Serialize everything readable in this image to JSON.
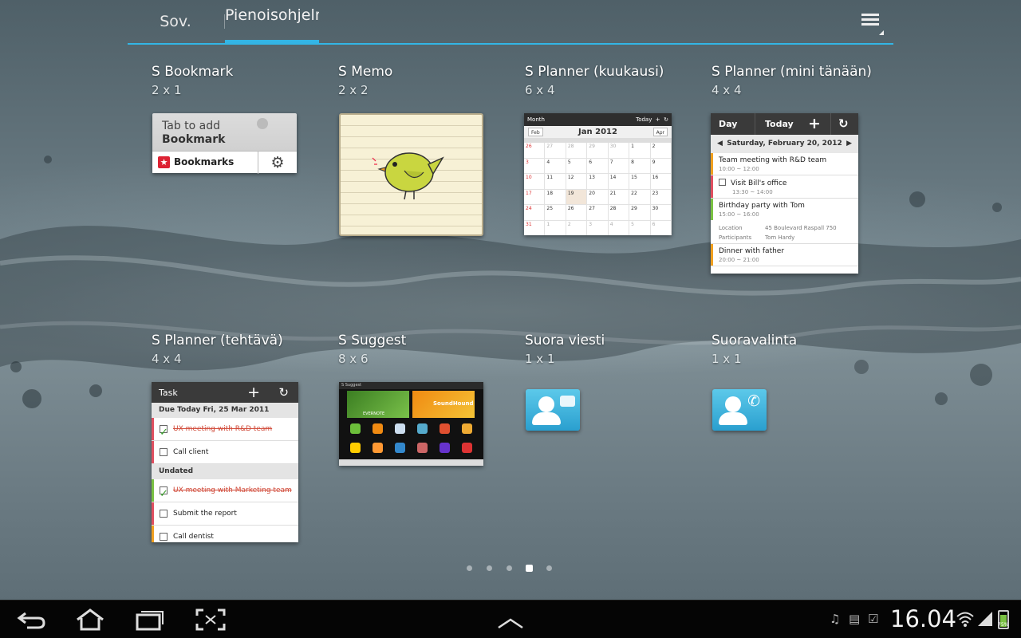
{
  "tabs": {
    "apps": "Sov.",
    "widgets": "Pienoisohjelmat"
  },
  "widgets": [
    {
      "title": "S Bookmark",
      "size": "2 x 1"
    },
    {
      "title": "S Memo",
      "size": "2 x 2"
    },
    {
      "title": "S Planner (kuukausi)",
      "size": "6 x 4"
    },
    {
      "title": "S Planner (mini tänään)",
      "size": "4 x 4"
    },
    {
      "title": "S Planner (tehtävä)",
      "size": "4 x 4"
    },
    {
      "title": "S Suggest",
      "size": "8 x 6"
    },
    {
      "title": "Suora viesti",
      "size": "1 x 1"
    },
    {
      "title": "Suoravalinta",
      "size": "1 x 1"
    }
  ],
  "bookmark": {
    "line1": "Tab to add",
    "line2": "Bookmark",
    "button": "Bookmarks"
  },
  "month": {
    "header": "Month",
    "today": "Today",
    "prev": "Feb",
    "title": "Jan 2012",
    "next": "Apr",
    "days": [
      "26",
      "27",
      "28",
      "29",
      "30",
      "1",
      "2",
      "3",
      "4",
      "5",
      "6",
      "7",
      "8",
      "9",
      "10",
      "11",
      "12",
      "13",
      "14",
      "15",
      "16",
      "17",
      "18",
      "19",
      "20",
      "21",
      "22",
      "23",
      "24",
      "25",
      "26",
      "27",
      "28",
      "29",
      "30",
      "31",
      "1",
      "2",
      "3",
      "4",
      "5",
      "6"
    ]
  },
  "today": {
    "tab_day": "Day",
    "tab_today": "Today",
    "date": "Saturday, February 20, 2012",
    "events": [
      {
        "title": "Team meeting with R&D team",
        "time": "10:00 ~ 12:00",
        "color": "#f0a020"
      },
      {
        "title": "Visit Bill's office",
        "time": "13:30 ~ 14:00",
        "color": "#e05060",
        "check": true
      },
      {
        "title": "Birthday party with Tom",
        "time": "15:00 ~ 16:00",
        "color": "#7ac143"
      },
      {
        "title": "Dinner with father",
        "time": "20:00 ~ 21:00",
        "color": "#f0a020"
      }
    ],
    "location_label": "Location",
    "location_value": "45 Boulevard Raspall 750",
    "participants_label": "Participants",
    "participants_value": "Tom Hardy"
  },
  "task": {
    "title": "Task",
    "section1": "Due Today Fri, 25 Mar 2011",
    "section2": "Undated",
    "rows": [
      {
        "text": "UX meeting with R&D team",
        "done": true,
        "color": "#e05060"
      },
      {
        "text": "Call client",
        "done": false,
        "color": "#e05060"
      },
      {
        "text": "UX meeting with Marketing team",
        "done": true,
        "color": "#7ac143"
      },
      {
        "text": "Submit the report",
        "done": false,
        "color": "#e05060"
      },
      {
        "text": "Call dentist",
        "done": false,
        "color": "#f0a020"
      }
    ]
  },
  "suggest": {
    "header": "S Suggest",
    "b1": "EVERNOTE",
    "b2": "SoundHound"
  },
  "pages": {
    "count": 5,
    "active": 3
  },
  "status": {
    "clock": "16.04",
    "battery": "75%"
  }
}
